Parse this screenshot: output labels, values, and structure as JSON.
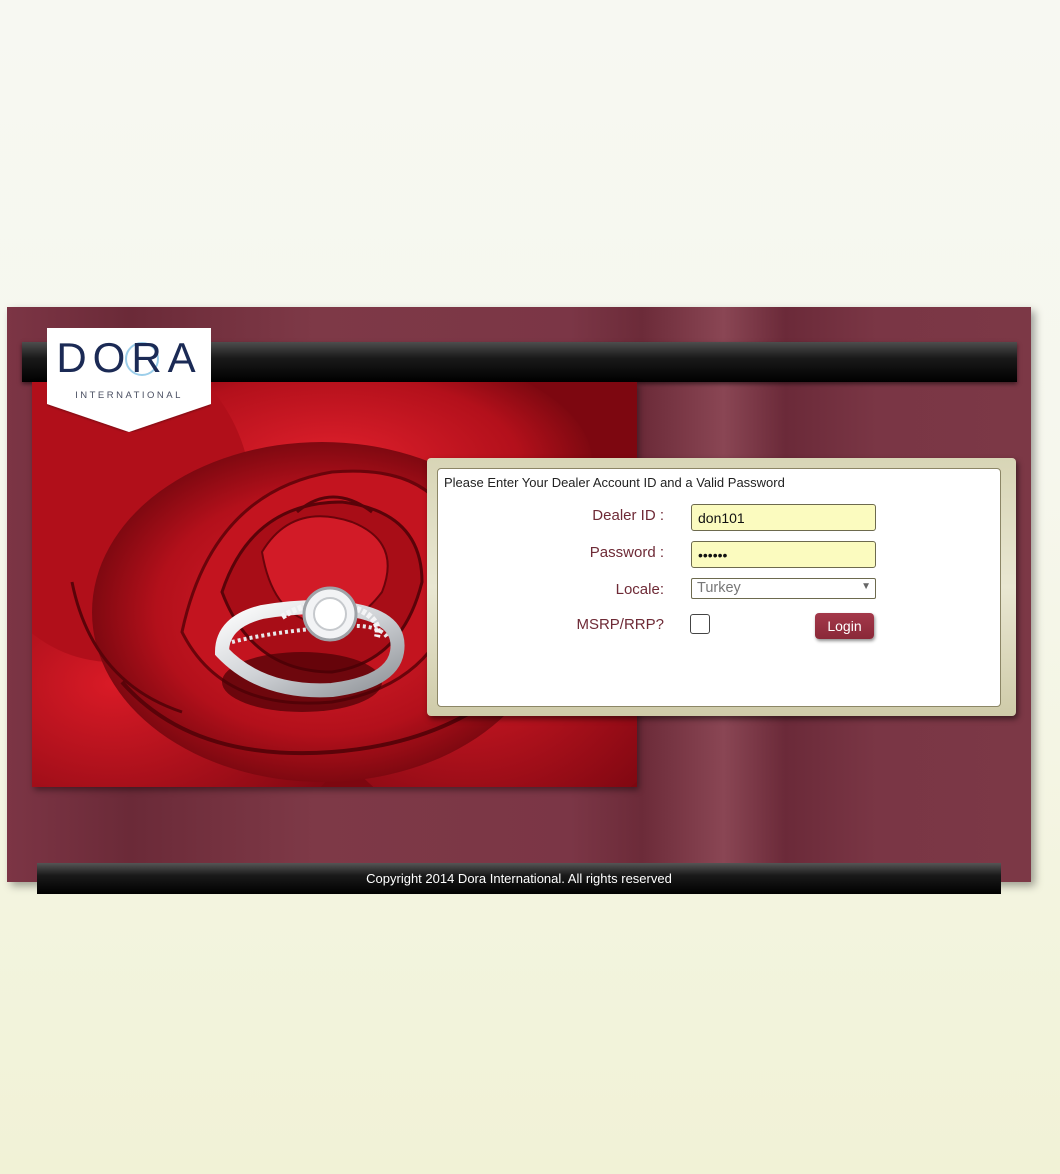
{
  "brand": {
    "logo_text": "DORA",
    "logo_subtext": "INTERNATIONAL"
  },
  "login": {
    "heading": "Please Enter Your Dealer Account ID and a Valid Password",
    "dealer_id_label": "Dealer ID :",
    "dealer_id_value": "don101",
    "password_label": "Password :",
    "password_value": "••••••",
    "locale_label": "Locale:",
    "locale_value": "Turkey",
    "msrp_label": "MSRP/RRP?",
    "msrp_checked": false,
    "login_button": "Login"
  },
  "footer": {
    "copyright": "Copyright 2014 Dora International. All rights reserved"
  },
  "colors": {
    "panel": "#7c3545",
    "accent_label": "#6e2a36",
    "button": "#9a3243",
    "input_bg": "#fbfbbf"
  },
  "icons": {
    "select_arrow": "dropdown-arrow-icon"
  }
}
